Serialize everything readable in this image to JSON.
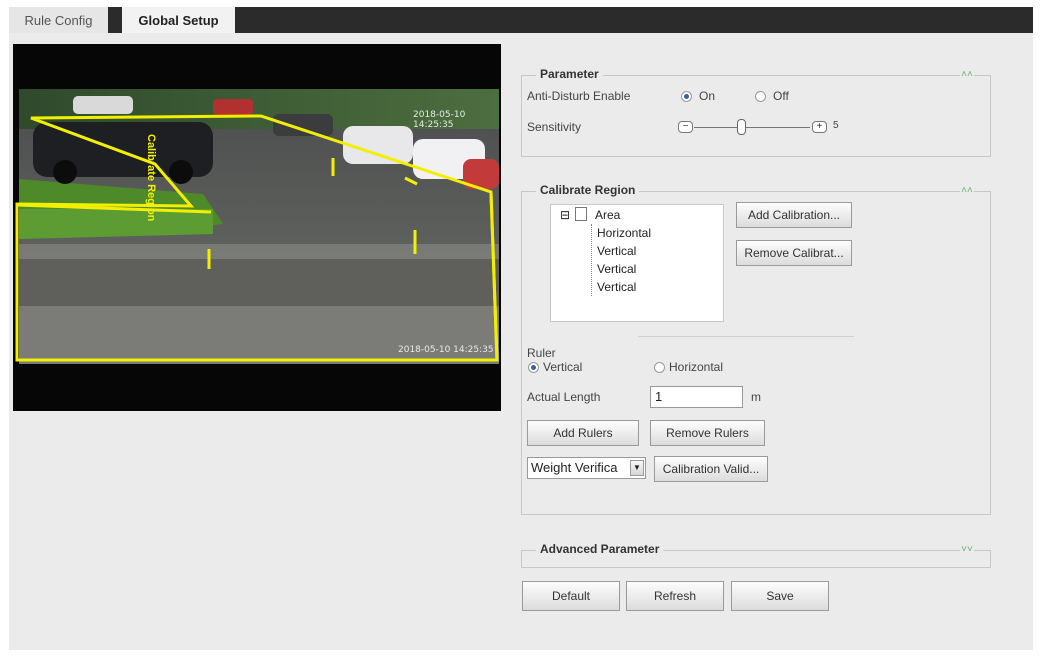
{
  "tabs": [
    {
      "label": "Rule Config"
    },
    {
      "label": "Global Setup"
    }
  ],
  "video": {
    "overlay_label": "Calibrate Region",
    "timestamp_top": "2018-05-10 14:25:35",
    "timestamp_bottom": "2018-05-10 14:25:35"
  },
  "parameter": {
    "title": "Parameter",
    "anti_disturb_label": "Anti-Disturb Enable",
    "on_label": "On",
    "off_label": "Off",
    "selected": "On",
    "sensitivity_label": "Sensitivity",
    "sensitivity_value": "5"
  },
  "calibrate": {
    "title": "Calibrate Region",
    "tree": {
      "root": "Area",
      "children": [
        "Horizontal",
        "Vertical",
        "Vertical",
        "Vertical"
      ]
    },
    "add_calibration": "Add Calibration...",
    "remove_calibration": "Remove Calibrat...",
    "ruler_label": "Ruler",
    "ruler_vertical": "Vertical",
    "ruler_horizontal": "Horizontal",
    "ruler_selected": "Vertical",
    "actual_length_label": "Actual Length",
    "actual_length_value": "1",
    "unit": "m",
    "add_rulers": "Add Rulers",
    "remove_rulers": "Remove Rulers",
    "verify_select": "Weight Verifica",
    "calibration_valid": "Calibration Valid..."
  },
  "advanced": {
    "title": "Advanced Parameter"
  },
  "buttons": {
    "default": "Default",
    "refresh": "Refresh",
    "save": "Save"
  },
  "colors": {
    "tabbar": "#2b2b2b",
    "panel": "#ebebeb",
    "overlay": "#f2f000",
    "collapse_icon": "#6cb36c"
  }
}
